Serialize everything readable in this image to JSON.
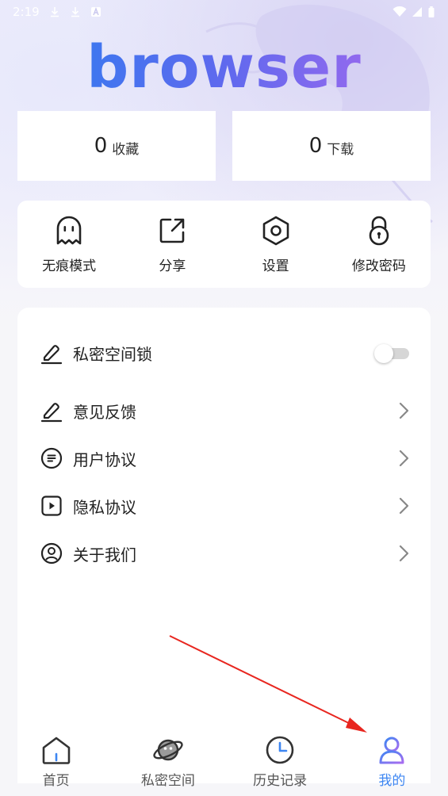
{
  "status_bar": {
    "time": "2:19",
    "icons_left": [
      "download-icon",
      "download-icon",
      "font-icon"
    ],
    "icons_right": [
      "wifi-icon",
      "signal-icon",
      "battery-icon"
    ]
  },
  "logo": {
    "text": "browser"
  },
  "stats": [
    {
      "count": "0",
      "label": "收藏"
    },
    {
      "count": "0",
      "label": "下载"
    }
  ],
  "actions": [
    {
      "label": "无痕模式",
      "icon": "ghost-icon"
    },
    {
      "label": "分享",
      "icon": "share-icon"
    },
    {
      "label": "设置",
      "icon": "settings-hex-icon"
    },
    {
      "label": "修改密码",
      "icon": "lock-icon"
    }
  ],
  "menu": [
    {
      "label": "私密空间锁",
      "icon": "pen-icon",
      "control": "toggle",
      "toggle_on": false
    },
    {
      "label": "意见反馈",
      "icon": "pen-icon",
      "control": "chevron"
    },
    {
      "label": "用户协议",
      "icon": "doc-circle-icon",
      "control": "chevron"
    },
    {
      "label": "隐私协议",
      "icon": "play-square-icon",
      "control": "chevron"
    },
    {
      "label": "关于我们",
      "icon": "user-circle-icon",
      "control": "chevron"
    }
  ],
  "bottom_nav": [
    {
      "label": "首页",
      "icon": "home-icon",
      "active": false
    },
    {
      "label": "私密空间",
      "icon": "planet-icon",
      "active": false
    },
    {
      "label": "历史记录",
      "icon": "clock-icon",
      "active": false
    },
    {
      "label": "我的",
      "icon": "profile-icon",
      "active": true
    }
  ],
  "colors": {
    "accent": "#3d86f2",
    "logo_gradient": [
      "#2a7ff0",
      "#b069ee"
    ],
    "annotation_arrow": "#e8261f"
  }
}
